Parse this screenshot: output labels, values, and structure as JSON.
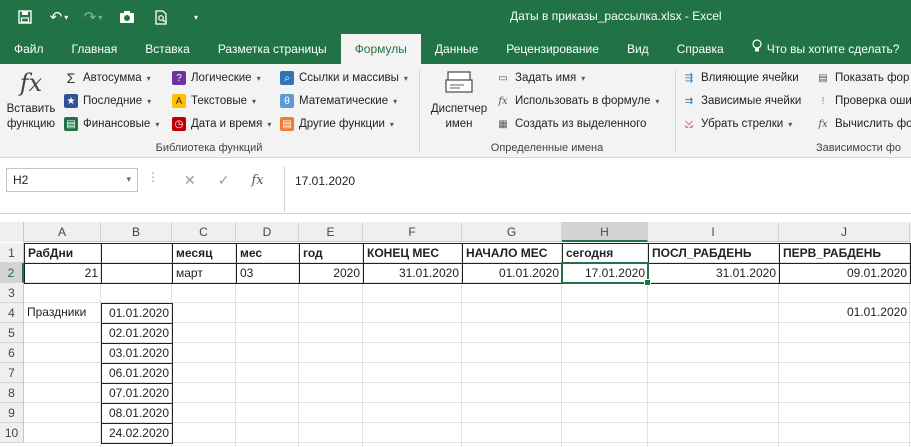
{
  "window": {
    "title": "Даты в приказы_рассылка.xlsx  -  Excel"
  },
  "tabs": [
    {
      "label": "Файл"
    },
    {
      "label": "Главная"
    },
    {
      "label": "Вставка"
    },
    {
      "label": "Разметка страницы"
    },
    {
      "label": "Формулы"
    },
    {
      "label": "Данные"
    },
    {
      "label": "Рецензирование"
    },
    {
      "label": "Вид"
    },
    {
      "label": "Справка"
    },
    {
      "label": "Что вы хотите сделать?"
    }
  ],
  "ribbon": {
    "function_library": {
      "group_label": "Библиотека функций",
      "insert_function_line1": "Вставить",
      "insert_function_line2": "функцию",
      "autosum": "Автосумма",
      "recent": "Последние",
      "financial": "Финансовые",
      "logical": "Логические",
      "text": "Текстовые",
      "datetime": "Дата и время",
      "lookup": "Ссылки и массивы",
      "math": "Математические",
      "more": "Другие функции"
    },
    "defined_names": {
      "group_label": "Определенные имена",
      "name_manager_line1": "Диспетчер",
      "name_manager_line2": "имен",
      "define_name": "Задать имя",
      "use_in_formula": "Использовать в формуле",
      "create_from_selection": "Создать из выделенного"
    },
    "formula_auditing": {
      "group_label": "Зависимости фо",
      "trace_precedents": "Влияющие ячейки",
      "trace_dependents": "Зависимые ячейки",
      "remove_arrows": "Убрать стрелки",
      "show_formulas": "Показать фор",
      "error_checking": "Проверка оши",
      "evaluate_formula": "Вычислить фор"
    }
  },
  "formula_bar": {
    "name_box": "H2",
    "content": "17.01.2020"
  },
  "sheet": {
    "columns": [
      "A",
      "B",
      "C",
      "D",
      "E",
      "F",
      "G",
      "H",
      "I",
      "J"
    ],
    "rows": [
      "1",
      "2",
      "3",
      "4",
      "5",
      "6",
      "7",
      "8",
      "9",
      "10"
    ],
    "selected_column": "H",
    "selected_cell": "H2",
    "header_row": {
      "A": "РабДни",
      "C": "месяц",
      "D": "мес",
      "E": "год",
      "F": "КОНЕЦ МЕС",
      "G": "НАЧАЛО МЕС",
      "H": "сегодня",
      "I": "ПОСЛ_РАБДЕНЬ",
      "J": "ПЕРВ_РАБДЕНЬ"
    },
    "row2": {
      "A": "21",
      "C": "март",
      "D": "03",
      "E": "2020",
      "F": "31.01.2020",
      "G": "01.01.2020",
      "H": "17.01.2020",
      "I": "31.01.2020",
      "J": "09.01.2020"
    },
    "holidays_label": "Праздники",
    "holidays": [
      "01.01.2020",
      "02.01.2020",
      "03.01.2020",
      "06.01.2020",
      "07.01.2020",
      "08.01.2020",
      "24.02.2020"
    ],
    "j4": "01.01.2020"
  },
  "colors": {
    "accent": "#217346"
  }
}
